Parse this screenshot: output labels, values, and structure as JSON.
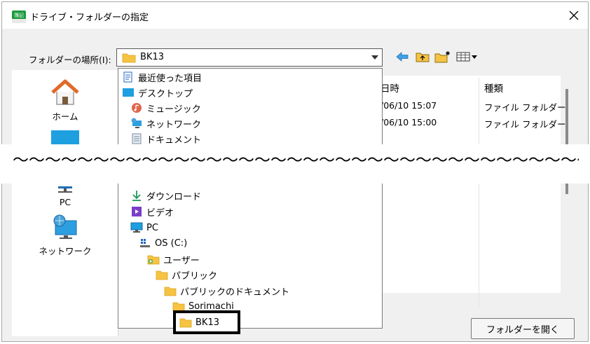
{
  "window": {
    "title": "ドライブ・フォルダーの指定",
    "icon_text": "簿記",
    "close_icon": "close-icon"
  },
  "folder_selector": {
    "label": "フォルダーの場所(I):",
    "value": "BK13"
  },
  "toolbar": [
    "back-arrow-icon",
    "up-folder-icon",
    "new-folder-icon",
    "view-menu-icon"
  ],
  "places": [
    {
      "label": "ホーム",
      "icon": "home-icon"
    },
    {
      "label": "PC",
      "icon": "pc-icon"
    },
    {
      "label": "ネットワーク",
      "icon": "network-icon"
    }
  ],
  "dropdown_items": [
    {
      "label": "最近使った項目",
      "icon": "recent-icon"
    },
    {
      "label": "デスクトップ",
      "icon": "desktop-icon"
    },
    {
      "label": "ミュージック",
      "icon": "music-icon"
    },
    {
      "label": "ネットワーク",
      "icon": "network-icon"
    },
    {
      "label": "ドキュメント",
      "icon": "document-icon"
    },
    {
      "label": "ダウンロード",
      "icon": "download-icon"
    },
    {
      "label": "ビデオ",
      "icon": "video-icon"
    },
    {
      "label": "PC",
      "icon": "pc-icon"
    },
    {
      "label": "OS (C:)",
      "icon": "drive-icon"
    },
    {
      "label": "ユーザー",
      "icon": "folder-icon"
    },
    {
      "label": "パブリック",
      "icon": "folder-icon"
    },
    {
      "label": "パブリックのドキュメント",
      "icon": "folder-icon"
    },
    {
      "label": "Sorimachi",
      "icon": "folder-icon"
    },
    {
      "label": "BK13",
      "icon": "folder-icon"
    }
  ],
  "file_list": {
    "headers": [
      "日時",
      "種類"
    ],
    "rows": [
      {
        "date": "/06/10 15:07",
        "type": "ファイル フォルダー"
      },
      {
        "date": "/06/10 15:00",
        "type": "ファイル フォルダー"
      }
    ]
  },
  "open_button": "フォルダーを開く",
  "break_wave": "〜〜〜〜〜〜〜〜〜〜〜〜〜〜〜〜〜〜〜〜〜〜〜〜〜〜〜〜〜〜〜〜〜〜〜〜〜〜"
}
